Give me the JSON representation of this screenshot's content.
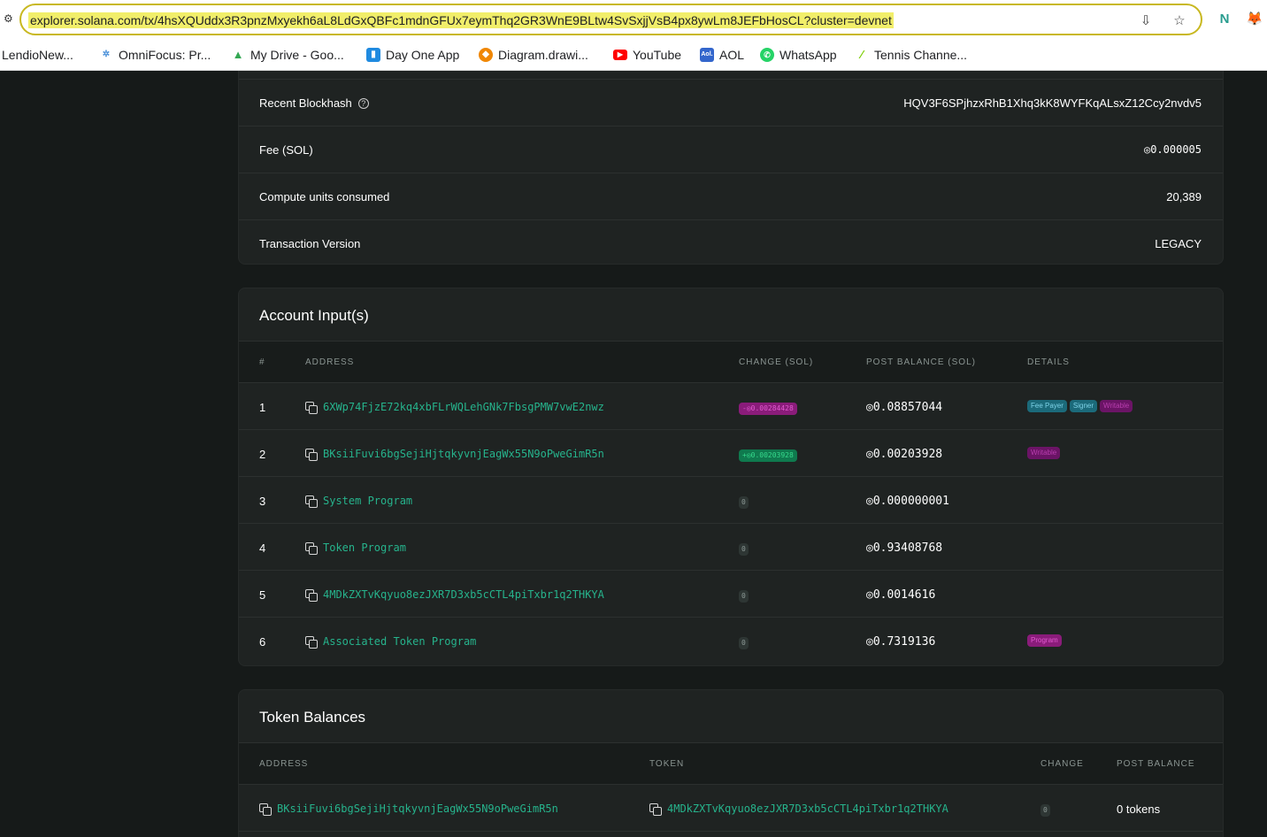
{
  "browser": {
    "url": "explorer.solana.com/tx/4hsXQUddx3R3pnzMxyekh6aL8LdGxQBFc1mdnGFUx7eymThq2GR3WnE9BLtw4SvSxjjVsB4px8ywLm8JEFbHosCL?cluster=devnet",
    "bookmarks": [
      {
        "label": "LendioNew...",
        "icon": "none"
      },
      {
        "label": "OmniFocus: Pr...",
        "icon": "omnifocus-icon"
      },
      {
        "label": "My Drive - Goo...",
        "icon": "google-drive-icon"
      },
      {
        "label": "Day One App",
        "icon": "day-one-icon"
      },
      {
        "label": "Diagram.drawi...",
        "icon": "drawio-icon"
      },
      {
        "label": "YouTube",
        "icon": "youtube-icon"
      },
      {
        "label": "AOL",
        "icon": "aol-icon"
      },
      {
        "label": "WhatsApp",
        "icon": "whatsapp-icon"
      },
      {
        "label": "Tennis Channe...",
        "icon": "tennis-channel-icon"
      }
    ]
  },
  "overview": {
    "rows": [
      {
        "label": "Recent Blockhash",
        "value": "HQV3F6SPjhzxRhB1Xhq3kK8WYFKqALsxZ12Ccy2nvdv5",
        "help": true
      },
      {
        "label": "Fee (SOL)",
        "value": "◎0.000005"
      },
      {
        "label": "Compute units consumed",
        "value": "20,389"
      },
      {
        "label": "Transaction Version",
        "value": "LEGACY"
      }
    ]
  },
  "account_inputs": {
    "title": "Account Input(s)",
    "columns": [
      "#",
      "ADDRESS",
      "CHANGE (SOL)",
      "POST BALANCE (SOL)",
      "DETAILS"
    ],
    "rows": [
      {
        "index": "1",
        "address": "6XWp74FjzE72kq4xbFLrWQLehGNk7FbsgPMW7vwE2nwz",
        "change": "-◎0.00284428",
        "change_type": "negative",
        "post_balance": "◎0.08857044",
        "details": [
          "Fee Payer",
          "Signer",
          "Writable"
        ]
      },
      {
        "index": "2",
        "address": "BKsiiFuvi6bgSejiHjtqkyvnjEagWx55N9oPweGimR5n",
        "change": "+◎0.00203928",
        "change_type": "positive",
        "post_balance": "◎0.00203928",
        "details": [
          "Writable"
        ]
      },
      {
        "index": "3",
        "address": "System Program",
        "change": "0",
        "change_type": "zero",
        "post_balance": "◎0.000000001",
        "details": []
      },
      {
        "index": "4",
        "address": "Token Program",
        "change": "0",
        "change_type": "zero",
        "post_balance": "◎0.93408768",
        "details": []
      },
      {
        "index": "5",
        "address": "4MDkZXTvKqyuo8ezJXR7D3xb5cCTL4piTxbr1q2THKYA",
        "change": "0",
        "change_type": "zero",
        "post_balance": "◎0.0014616",
        "details": []
      },
      {
        "index": "6",
        "address": "Associated Token Program",
        "change": "0",
        "change_type": "zero",
        "post_balance": "◎0.7319136",
        "details": [
          "Program"
        ]
      }
    ]
  },
  "token_balances": {
    "title": "Token Balances",
    "columns": [
      "ADDRESS",
      "TOKEN",
      "CHANGE",
      "POST BALANCE"
    ],
    "rows": [
      {
        "address": "BKsiiFuvi6bgSejiHjtqkyvnjEagWx55N9oPweGimR5n",
        "token": "4MDkZXTvKqyuo8ezJXR7D3xb5cCTL4piTxbr1q2THKYA",
        "change": "0",
        "post_balance": "0 tokens"
      }
    ]
  },
  "colors": {
    "background": "#161a19",
    "card": "#1f2322",
    "accent_green": "#26b38c",
    "negative": "#e15ad0",
    "positive": "#36d98c"
  }
}
